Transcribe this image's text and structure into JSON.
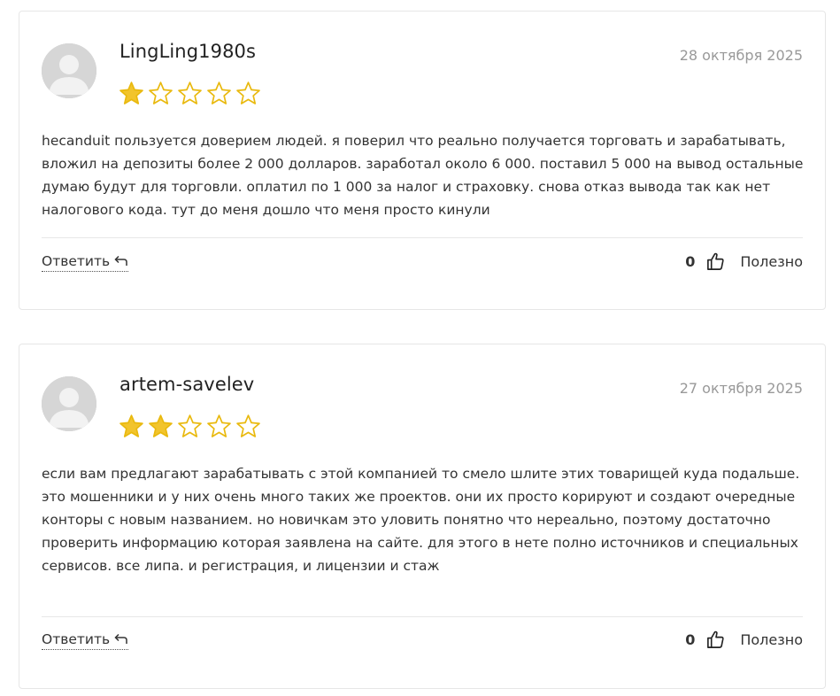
{
  "colors": {
    "star": "#f2c42c",
    "star_outline": "#e9b90e",
    "divider": "#e8e8e8",
    "date": "#999999"
  },
  "reviews": [
    {
      "author": "LingLing1980s",
      "date": "28 октября 2025",
      "rating": 1,
      "max_rating": 5,
      "text": "hecanduit пользуется доверием людей. я поверил что реально получается торговать и зарабатывать, вложил на депозиты более 2 000 долларов. заработал около 6 000. поставил 5 000 на вывод остальные думаю будут для торговли. оплатил по 1 000 за налог и страховку. снова отказ вывода так как нет налогового кода. тут до меня дошло что меня просто кинули",
      "reply_label": "Ответить",
      "likes": "0",
      "helpful_label": "Полезно",
      "icons": {
        "avatar": "avatar-placeholder-icon",
        "reply": "reply-arrow-icon",
        "like": "thumbs-up-icon"
      }
    },
    {
      "author": "artem-savelev",
      "date": "27 октября 2025",
      "rating": 2,
      "max_rating": 5,
      "text": "если вам предлагают зарабатывать с этой компанией то смело шлите этих товарищей куда подальше. это мошенники и у них очень много таких же проектов. они их просто корируют и создают очередные конторы с новым названием. но новичкам это уловить понятно что нереально, поэтому достаточно проверить информацию которая заявлена на сайте. для этого в нете полно источников и специальных сервисов. все липа. и регистрация, и лицензии и стаж",
      "reply_label": "Ответить",
      "likes": "0",
      "helpful_label": "Полезно",
      "icons": {
        "avatar": "avatar-placeholder-icon",
        "reply": "reply-arrow-icon",
        "like": "thumbs-up-icon"
      }
    }
  ]
}
